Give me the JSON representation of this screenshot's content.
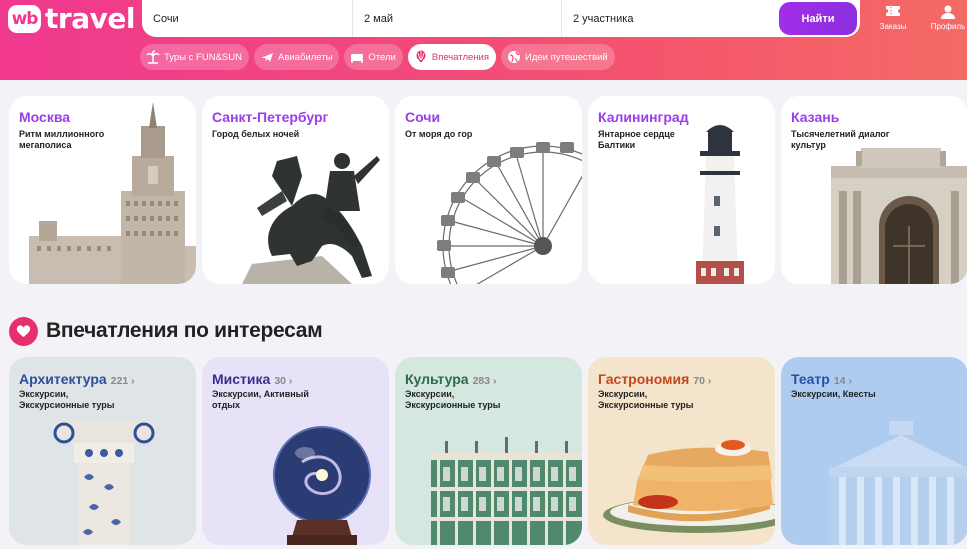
{
  "brand": {
    "badge": "wb",
    "name": "travel"
  },
  "search": {
    "destination": "Сочи",
    "date": "2 май",
    "guests": "2 участника",
    "button_label": "Найти"
  },
  "header_actions": [
    {
      "icon": "ticket-icon",
      "label": "Заказы"
    },
    {
      "icon": "profile-icon",
      "label": "Профиль"
    }
  ],
  "nav_chips": [
    {
      "icon": "palm-icon",
      "label": "Туры с FUN&SUN",
      "active": false
    },
    {
      "icon": "plane-icon",
      "label": "Авиабилеты",
      "active": false
    },
    {
      "icon": "bed-icon",
      "label": "Отели",
      "active": false
    },
    {
      "icon": "balloon-icon",
      "label": "Впечатления",
      "active": true
    },
    {
      "icon": "globe-icon",
      "label": "Идеи путешествий",
      "active": false
    }
  ],
  "cities": [
    {
      "name": "Москва",
      "tagline": "Ритм миллионного мегаполиса"
    },
    {
      "name": "Санкт-Петербург",
      "tagline": "Город белых ночей"
    },
    {
      "name": "Сочи",
      "tagline": "От моря до гор"
    },
    {
      "name": "Калининград",
      "tagline": "Янтарное сердце Балтики"
    },
    {
      "name": "Казань",
      "tagline": "Тысячелетний диалог культур"
    }
  ],
  "interests_section": {
    "title": "Впечатления по интересам"
  },
  "interests": [
    {
      "name": "Архитектура",
      "count": "221 ›",
      "tags": "Экскурсии, Экскурсионные туры",
      "bg": "#dfe4e6",
      "color": "#2c4f9e"
    },
    {
      "name": "Мистика",
      "count": "30 ›",
      "tags": "Экскурсии, Активный отдых",
      "bg": "#e7e2f8",
      "color": "#3b2f8e"
    },
    {
      "name": "Культура",
      "count": "283 ›",
      "tags": "Экскурсии, Экскурсионные туры",
      "bg": "#d5e8df",
      "color": "#2e6a4c"
    },
    {
      "name": "Гастрономия",
      "count": "70 ›",
      "tags": "Экскурсии, Экскурсионные туры",
      "bg": "#f4e4cb",
      "color": "#c4471d"
    },
    {
      "name": "Театр",
      "count": "14 ›",
      "tags": "Экскурсии, Квесты",
      "bg": "#aecbf0",
      "color": "#2a4fa6"
    }
  ]
}
